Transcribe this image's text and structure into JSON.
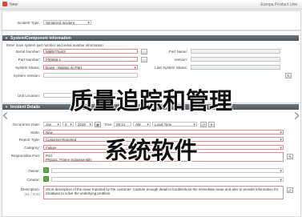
{
  "window": {
    "title": "New",
    "product": "Europa Product Line"
  },
  "incident_type": {
    "label": "Incident Type:",
    "value": "Serialized Incident"
  },
  "section_system": {
    "title": "System/Component Information",
    "hint": "Enter main system part number and serial number information:",
    "fields": {
      "serial_number": {
        "label": "Serial Number:",
        "value": "MMB775v03"
      },
      "part_number": {
        "label": "Part Number:",
        "value": "P00065-1"
      },
      "system_status": {
        "label": "System Status:",
        "value": "Down - Waiting on Part"
      },
      "system_version": {
        "label": "System Version:",
        "value": ""
      },
      "unit_location": {
        "label": "Unit Location:",
        "value": ""
      },
      "part_name": {
        "label": "Part Name:",
        "value": ""
      },
      "version": {
        "label": "Version:",
        "value": ""
      },
      "last_system_status": {
        "label": "Last System Status:",
        "value": ""
      }
    }
  },
  "section_incident": {
    "title": "Incident Details",
    "occurrence_date": {
      "label": "Occurence Date:",
      "month": "Jan",
      "day": "9",
      "year": "2019",
      "time_label": "Time:",
      "time": "09:14",
      "ampm": "AM",
      "tz": "Local Time"
    },
    "state": {
      "label": "State:",
      "value": "New"
    },
    "report_type": {
      "label": "Report Type:",
      "value": "Customer Reported"
    },
    "category": {
      "label": "Category:",
      "value": "Failure"
    },
    "responsible_part": {
      "label": "Responsible Part:",
      "value1": "Pod",
      "value2": "PN1111: Frame Subassembly"
    },
    "owner": {
      "label": "Owner:"
    },
    "creator": {
      "label": "Creator:"
    },
    "description": {
      "label": "Description:",
      "counter": "(91 / 400)",
      "value": "Short description of the issue reported by the customer. Capture enough detail to troubleshoot the immediate issue and also to provide information for initiatives to solve the underlying problem."
    }
  },
  "overlay": {
    "line1": "质量追踪和管理",
    "line2": "系统软件"
  },
  "nav": {
    "prev": "‹",
    "next": "›"
  },
  "colors": {
    "header": "#4e555c",
    "required_border": "#d98b8b",
    "accent": "#d64533"
  }
}
